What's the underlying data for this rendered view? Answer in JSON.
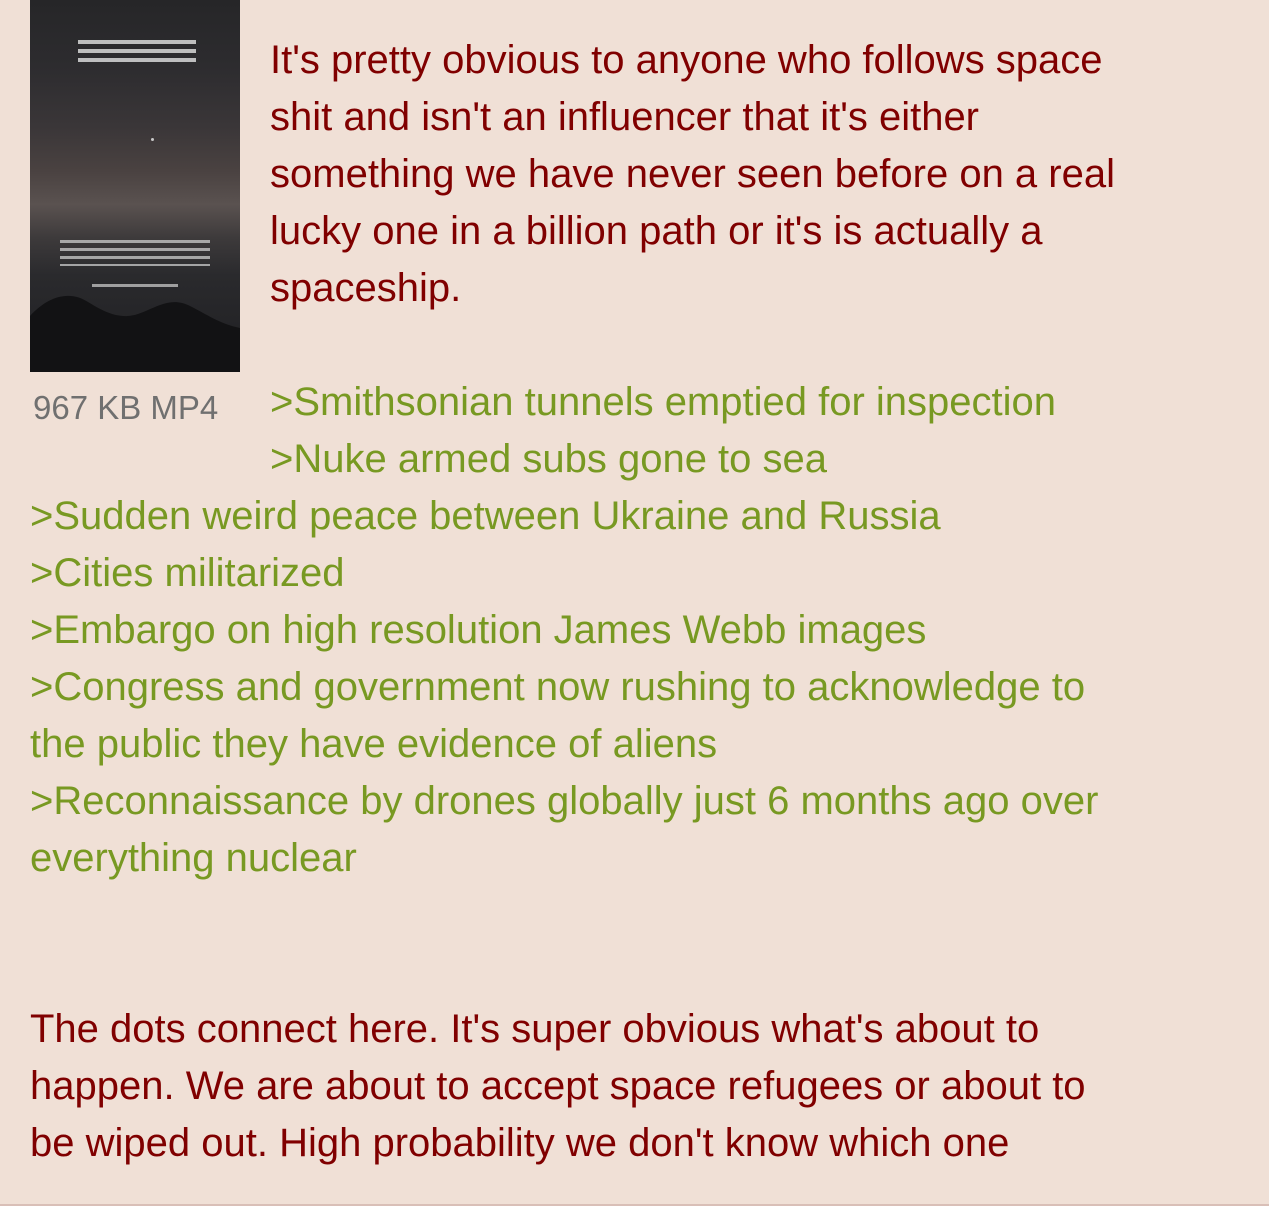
{
  "post": {
    "file_info": "967 KB MP4",
    "intro": [
      "It's pretty obvious to anyone who follows space",
      "shit and isn't an influencer that it's either",
      "something we have never seen before on a real",
      "lucky one in a billion path or it's is actually a",
      "spaceship."
    ],
    "greentext": [
      ">Smithsonian tunnels emptied for inspection",
      ">Nuke armed subs gone to sea",
      ">Sudden weird peace between Ukraine and Russia",
      ">Cities militarized",
      ">Embargo on high resolution James Webb images",
      ">Congress and government now rushing to acknowledge to",
      "the public they have evidence of aliens",
      ">Reconnaissance by drones globally just 6 months ago over",
      "everything nuclear"
    ],
    "conclusion": [
      "The dots connect here. It's super obvious what's about to",
      "happen. We are about to accept space refugees or about to",
      "be wiped out. High probability we don't know which one"
    ]
  },
  "colors": {
    "background": "#f0e0d6",
    "text": "#800000",
    "greentext": "#789922",
    "file_info": "#707070"
  },
  "icons": {
    "thumbnail": "video-thumbnail"
  }
}
